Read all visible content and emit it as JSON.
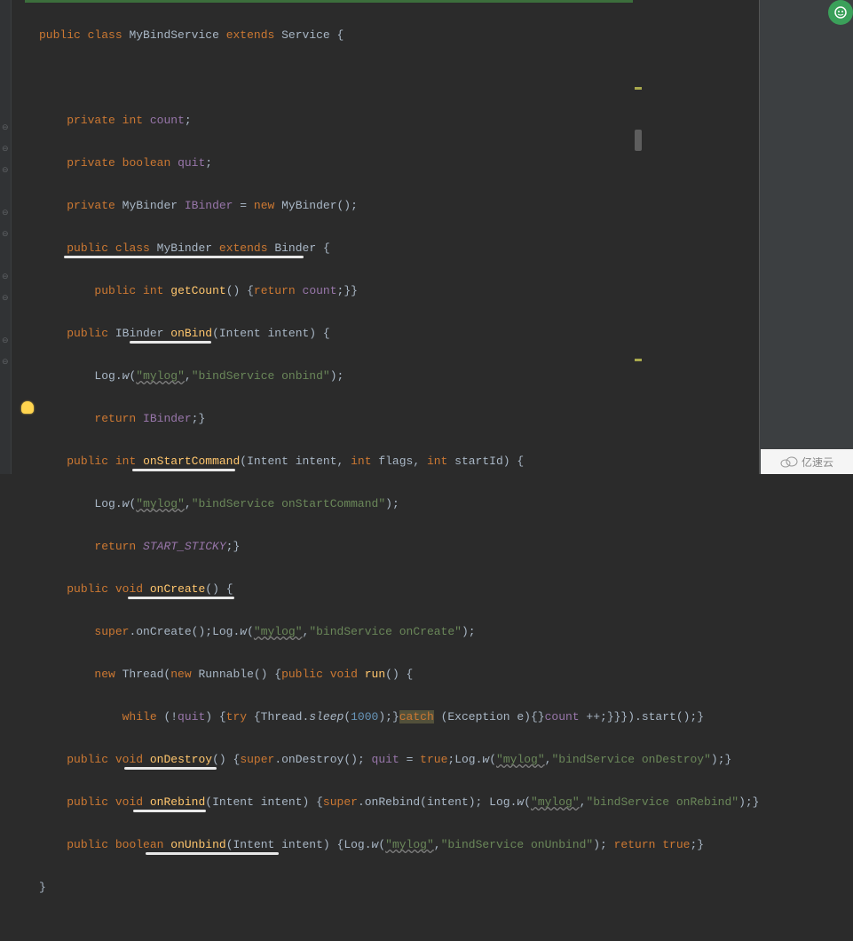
{
  "code": {
    "l1_kw1": "public",
    "l1_kw2": "class",
    "l1_name": "MyBindService",
    "l1_kw3": "extends",
    "l1_type": "Service",
    "l1_brace": " {",
    "l3_kw1": "private",
    "l3_kw2": "int",
    "l3_field": "count",
    "l3_semi": ";",
    "l4_kw1": "private",
    "l4_kw2": "boolean",
    "l4_field": "quit",
    "l4_semi": ";",
    "l5_kw1": "private",
    "l5_type1": "MyBinder",
    "l5_field": "IBinder",
    "l5_eq": " = ",
    "l5_kw2": "new",
    "l5_type2": " MyBinder()",
    "l5_semi": ";",
    "l6_kw1": "public",
    "l6_kw2": "class",
    "l6_name": "MyBinder",
    "l6_kw3": "extends",
    "l6_type": "Binder",
    "l6_brace": " {",
    "l7_kw1": "public",
    "l7_kw2": "int",
    "l7_method": "getCount",
    "l7_paren": "() {",
    "l7_kw3": "return",
    "l7_field": "count",
    "l7_end": ";}}",
    "l8_kw1": "public",
    "l8_type": "IBinder",
    "l8_method": "onBind",
    "l8_sig": "(Intent intent) {",
    "l9_cls": "Log",
    "l9_dot": ".",
    "l9_m": "w",
    "l9_open": "(",
    "l9_str1": "\"mylog\"",
    "l9_comma": ",",
    "l9_str2": "\"bindService onbind\"",
    "l9_close": ")",
    "l9_semi": ";",
    "l10_kw": "return",
    "l10_field": "IBinder",
    "l10_end": ";}",
    "l11_kw1": "public",
    "l11_kw2": "int",
    "l11_method": "onStartCommand",
    "l11_p1": "(Intent intent",
    "l11_c1": ", ",
    "l11_kw3": "int",
    "l11_p2": " flags",
    "l11_c2": ", ",
    "l11_kw4": "int",
    "l11_p3": " startId) {",
    "l12_cls": "Log",
    "l12_dot": ".",
    "l12_m": "w",
    "l12_open": "(",
    "l12_str1": "\"mylog\"",
    "l12_comma": ",",
    "l12_str2": "\"bindService onStartCommand\"",
    "l12_close": ")",
    "l12_semi": ";",
    "l13_kw": "return",
    "l13_const": "START_STICKY",
    "l13_end": ";}",
    "l14_kw1": "public",
    "l14_kw2": "void",
    "l14_method": "onCreate",
    "l14_sig": "() {",
    "l15_kw": "super",
    "l15_call": ".onCreate();",
    "l15_cls": "Log",
    "l15_dot": ".",
    "l15_m": "w",
    "l15_open": "(",
    "l15_str1": "\"mylog\"",
    "l15_comma": ",",
    "l15_str2": "\"bindService onCreate\"",
    "l15_close": ")",
    "l15_semi": ";",
    "l16_kw1": "new",
    "l16_t1": " Thread(",
    "l16_kw2": "new",
    "l16_t2": " Runnable() {",
    "l16_kw3": "public",
    "l16_sp1": " ",
    "l16_kw4": "void",
    "l16_sp2": " ",
    "l16_method": "run",
    "l16_sig": "() {",
    "l17_kw1": "while",
    "l17_open": " (!",
    "l17_field1": "quit",
    "l17_close1": ") {",
    "l17_kw2": "try",
    "l17_open2": " {Thread.",
    "l17_sleep": "sleep",
    "l17_p": "(",
    "l17_num": "1000",
    "l17_close2": ");}",
    "l17_kw3": "catch",
    "l17_catch": " (Exception e){}",
    "l17_field2": "count",
    "l17_inc": " ++;}}}).start();}",
    "l18_kw1": "public",
    "l18_kw2": "void",
    "l18_method": "onDestroy",
    "l18_sig": "() {",
    "l18_kw3": "super",
    "l18_call": ".onDestroy(); ",
    "l18_field": "quit",
    "l18_eq": " = ",
    "l18_kw4": "true",
    "l18_semi": ";",
    "l18_cls": "Log",
    "l18_dot": ".",
    "l18_m": "w",
    "l18_open": "(",
    "l18_str1": "\"mylog\"",
    "l18_comma": ",",
    "l18_str2": "\"bindService onDestroy\"",
    "l18_close": ");}",
    "l19_kw1": "public",
    "l19_kw2": "void",
    "l19_method": "onRebind",
    "l19_sig": "(Intent intent) {",
    "l19_kw3": "super",
    "l19_call": ".onRebind(intent); ",
    "l19_cls": "Log",
    "l19_dot": ".",
    "l19_m": "w",
    "l19_open": "(",
    "l19_str1": "\"mylog\"",
    "l19_comma": ",",
    "l19_str2": "\"bindService onRebind\"",
    "l19_close": ");}",
    "l20_kw1": "public",
    "l20_kw2": "boolean",
    "l20_method": "onUnbind",
    "l20_sig": "(Intent intent) {",
    "l20_cls": "Log",
    "l20_dot": ".",
    "l20_m": "w",
    "l20_open": "(",
    "l20_str1": "\"mylog\"",
    "l20_comma": ",",
    "l20_str2": "\"bindService onUnbind\"",
    "l20_close": "); ",
    "l20_kw3": "return",
    "l20_sp": " ",
    "l20_kw4": "true",
    "l20_end": ";}",
    "l21": "}"
  },
  "watermark": "亿速云"
}
